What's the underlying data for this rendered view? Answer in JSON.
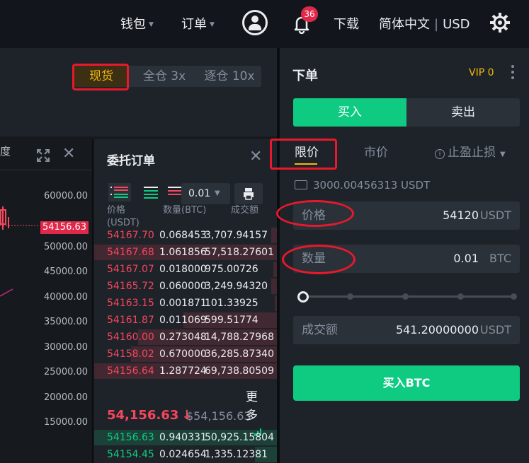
{
  "nav": {
    "wallet": "钱包",
    "orders": "订单",
    "notification_count": "36",
    "download": "下载",
    "language": "简体中文",
    "currency": "USD"
  },
  "margin_modes": [
    "现货",
    "全仓 3x",
    "逐仓 10x"
  ],
  "chart": {
    "depth_label": "度",
    "y_ticks": [
      "60000.00",
      "50000.00",
      "45000.00",
      "40000.00",
      "35000.00",
      "30000.00",
      "25000.00",
      "20000.00",
      "15000.00"
    ],
    "price_tag": "54156.63"
  },
  "order_book": {
    "title": "委托订单",
    "precision": "0.01",
    "col_price": "价格\n(USDT)",
    "col_amount": "数量(BTC)",
    "col_total": "成交额",
    "asks": [
      {
        "price": "54167.70",
        "amount": "0.068453",
        "total": "3,707.94157",
        "depth": 0.03
      },
      {
        "price": "54167.68",
        "amount": "1.061856",
        "total": "57,518.27601",
        "depth": 1.0
      },
      {
        "price": "54167.07",
        "amount": "0.018000",
        "total": "975.00726",
        "depth": 0.02
      },
      {
        "price": "54165.72",
        "amount": "0.060000",
        "total": "3,249.94320",
        "depth": 0.03
      },
      {
        "price": "54163.15",
        "amount": "0.001871",
        "total": "101.33925",
        "depth": 0.01
      },
      {
        "price": "54161.87",
        "amount": "0.011069",
        "total": "599.51774",
        "depth": 0.51
      },
      {
        "price": "54160.00",
        "amount": "0.273048",
        "total": "14,788.27968",
        "depth": 0.76
      },
      {
        "price": "54158.02",
        "amount": "0.670000",
        "total": "36,285.87340",
        "depth": 0.8
      },
      {
        "price": "54156.64",
        "amount": "1.287724",
        "total": "69,738.80509",
        "depth": 1.0
      }
    ],
    "last_price": "54,156.63",
    "last_price_arrow": "↓",
    "last_price_usd": "$54,156.63",
    "more": "更多",
    "bids": [
      {
        "price": "54156.63",
        "amount": "0.940331",
        "total": "50,925.15804",
        "depth": 1.0
      },
      {
        "price": "54154.45",
        "amount": "0.024654",
        "total": "1,335.12381",
        "depth": 0.12
      }
    ]
  },
  "order_form": {
    "title": "下单",
    "vip": "VIP 0",
    "buy_tab": "买入",
    "sell_tab": "卖出",
    "type_limit": "限价",
    "type_market": "市价",
    "type_stop": "止盈止损",
    "available": "3000.00456313 USDT",
    "price_label": "价格",
    "price_value": "54120",
    "price_unit": "USDT",
    "amount_label": "数量",
    "amount_value": "0.01",
    "amount_unit": "BTC",
    "slider_percent": 0,
    "total_label": "成交额",
    "total_value": "541.20000000",
    "total_unit": "USDT",
    "submit": "买入BTC"
  },
  "colors": {
    "buy": "#0ecb81",
    "sell": "#f6465d",
    "accent": "#f0b90b",
    "annotation": "#e8192c"
  }
}
